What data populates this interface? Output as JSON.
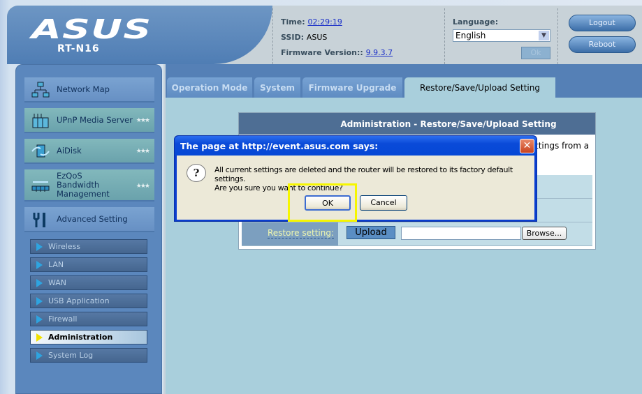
{
  "header": {
    "logo": "ASUS",
    "model": "RT-N16",
    "time_label": "Time:",
    "time": "02:29:19",
    "ssid_label": "SSID:",
    "ssid": "ASUS",
    "firmware_label": "Firmware Version::",
    "firmware": "9.9.3.7",
    "language_label": "Language:",
    "language": "English",
    "language_ok": "Ok",
    "logout": "Logout",
    "reboot": "Reboot"
  },
  "sidebar": {
    "menu": [
      {
        "label": "Network Map",
        "icon": "network-map-icon"
      },
      {
        "label": "UPnP Media Server",
        "icon": "media-server-icon"
      },
      {
        "label": "AiDisk",
        "icon": "aidisk-icon"
      },
      {
        "label": "EzQoS Bandwidth Management",
        "icon": "bandwidth-icon"
      },
      {
        "label": "Advanced Setting",
        "icon": "tools-icon"
      }
    ],
    "submenu": [
      "Wireless",
      "LAN",
      "WAN",
      "USB Application",
      "Firewall",
      "Administration",
      "System Log"
    ],
    "active": "Administration"
  },
  "tabs": [
    "Operation Mode",
    "System",
    "Firmware Upgrade",
    "Restore/Save/Upload Setting"
  ],
  "active_tab": "Restore/Save/Upload Setting",
  "panel": {
    "title": "Administration - Restore/Save/Upload Setting",
    "intro_fragment": "ttings from a",
    "restore_label": "Restore setting:",
    "upload": "Upload",
    "browse": "Browse..."
  },
  "dialog": {
    "title": "The page at http://event.asus.com says:",
    "line1": "All current settings are deleted and the router will be restored to its factory default settings.",
    "line2": "Are you sure you want to continue?",
    "ok": "OK",
    "cancel": "Cancel"
  },
  "colors": {
    "highlight": "#f6f600",
    "panel_header": "#4e6e94",
    "dialog_title": "#0a4ad8"
  }
}
